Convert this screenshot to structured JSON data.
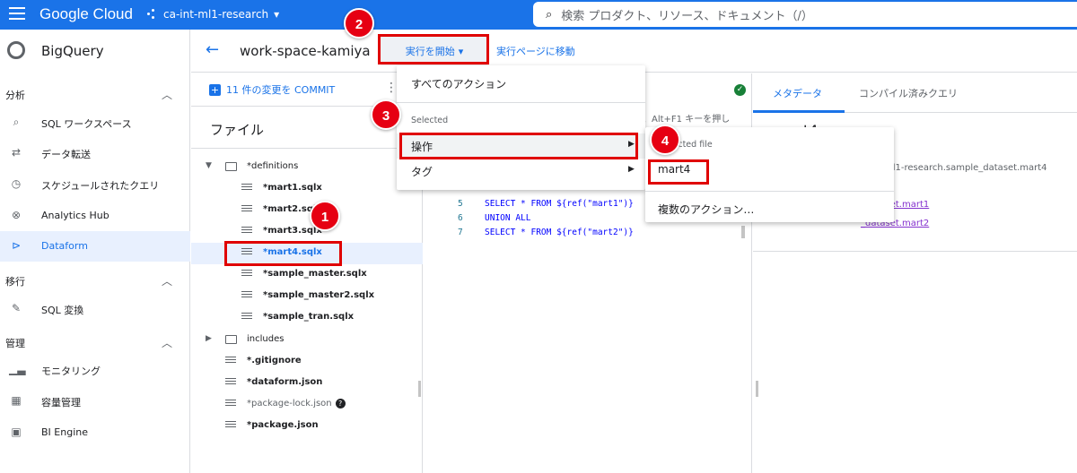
{
  "topbar": {
    "brand": "Google Cloud",
    "project": "ca-int-ml1-research",
    "search_placeholder": "検索  プロダクト、リソース、ドキュメント（/）"
  },
  "leftnav": {
    "title": "BigQuery",
    "sections": [
      {
        "label": "分析",
        "items": [
          "SQL ワークスペース",
          "データ転送",
          "スケジュールされたクエリ",
          "Analytics Hub",
          "Dataform"
        ]
      },
      {
        "label": "移行",
        "items": [
          "SQL 変換"
        ]
      },
      {
        "label": "管理",
        "items": [
          "モニタリング",
          "容量管理",
          "BI Engine"
        ]
      }
    ],
    "active_item": "Dataform"
  },
  "header": {
    "workspace": "work-space-kamiya",
    "start_button": "実行を開始",
    "goto_link": "実行ページに移動"
  },
  "filepanel": {
    "commit_label": "11 件の変更を COMMIT",
    "files_title": "ファイル",
    "tree": [
      {
        "name": "*definitions",
        "type": "folder",
        "expanded": true,
        "level": 0
      },
      {
        "name": "*mart1.sqlx",
        "type": "file",
        "level": 1
      },
      {
        "name": "*mart2.sqlx",
        "type": "file",
        "level": 1
      },
      {
        "name": "*mart3.sqlx",
        "type": "file",
        "level": 1
      },
      {
        "name": "*mart4.sqlx",
        "type": "file",
        "level": 1,
        "selected": true
      },
      {
        "name": "*sample_master.sqlx",
        "type": "file",
        "level": 1
      },
      {
        "name": "*sample_master2.sqlx",
        "type": "file",
        "level": 1
      },
      {
        "name": "*sample_tran.sqlx",
        "type": "file",
        "level": 1
      },
      {
        "name": "includes",
        "type": "folder",
        "expanded": false,
        "level": 0
      },
      {
        "name": "*.gitignore",
        "type": "file",
        "level": 0
      },
      {
        "name": "*dataform.json",
        "type": "file",
        "level": 0
      },
      {
        "name": "*package-lock.json",
        "type": "file",
        "level": 0,
        "help": true
      },
      {
        "name": "*package.json",
        "type": "file",
        "level": 0
      }
    ]
  },
  "editor": {
    "hint": "、Alt+F1 キーを押し",
    "lines": [
      {
        "num": "5",
        "text": "SELECT * FROM ${ref(\"mart1\")}"
      },
      {
        "num": "6",
        "text": "UNION ALL"
      },
      {
        "num": "7",
        "text": "SELECT * FROM ${ref(\"mart2\")}"
      }
    ]
  },
  "rightpanel": {
    "tabs": [
      "メタデータ",
      "コンパイル済みクエリ"
    ],
    "title": "mart4",
    "path": "ml1-research.sample_dataset.mart4",
    "dependencies": [
      "_dataset.mart1",
      "_dataset.mart2"
    ]
  },
  "menu1": {
    "all_actions": "すべてのアクション",
    "group_label": "Selected",
    "operate": "操作",
    "tag": "タグ"
  },
  "menu2": {
    "group_label": "Selected file",
    "file": "mart4",
    "multi": "複数のアクション…"
  },
  "annotations": {
    "badges": [
      "1",
      "2",
      "3",
      "4"
    ],
    "color": "#e00000"
  },
  "colors": {
    "brand_blue": "#1a73e8",
    "annotation_red": "#e00000"
  }
}
